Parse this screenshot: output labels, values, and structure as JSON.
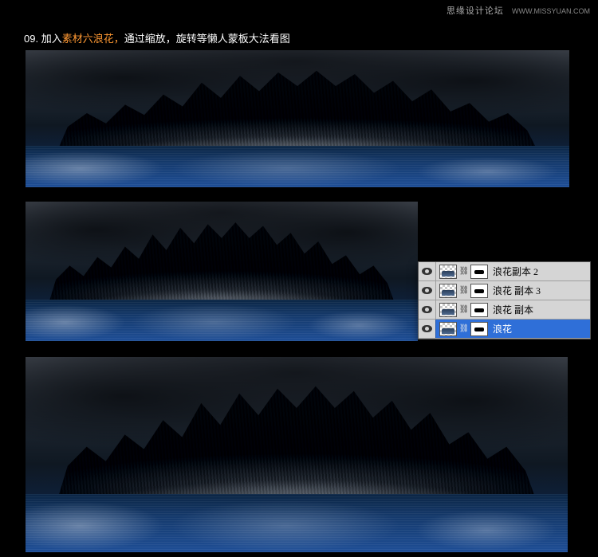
{
  "header": {
    "site_name": "思缘设计论坛",
    "site_url": "WWW.MISSYUAN.COM"
  },
  "step": {
    "number": "09.",
    "prefix": "加入",
    "highlight": "素材六浪花，",
    "rest": "通过缩放，旋转等懒人蒙板大法看图"
  },
  "layers_panel": {
    "rows": [
      {
        "name": "浪花副本 2",
        "selected": false
      },
      {
        "name": "浪花 副本 3",
        "selected": false
      },
      {
        "name": "浪花 副本",
        "selected": false
      },
      {
        "name": "浪花",
        "selected": true
      }
    ]
  },
  "colors": {
    "highlight": "#ff9933",
    "selection": "#2f6fd8"
  }
}
